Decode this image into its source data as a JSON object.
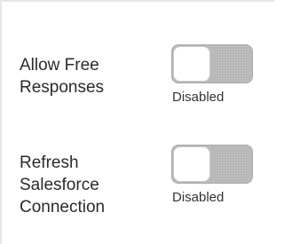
{
  "settings": [
    {
      "label": "Allow Free\nResponses",
      "status": "Disabled",
      "enabled": false
    },
    {
      "label": "Refresh\nSalesforce\nConnection",
      "status": "Disabled",
      "enabled": false
    }
  ]
}
